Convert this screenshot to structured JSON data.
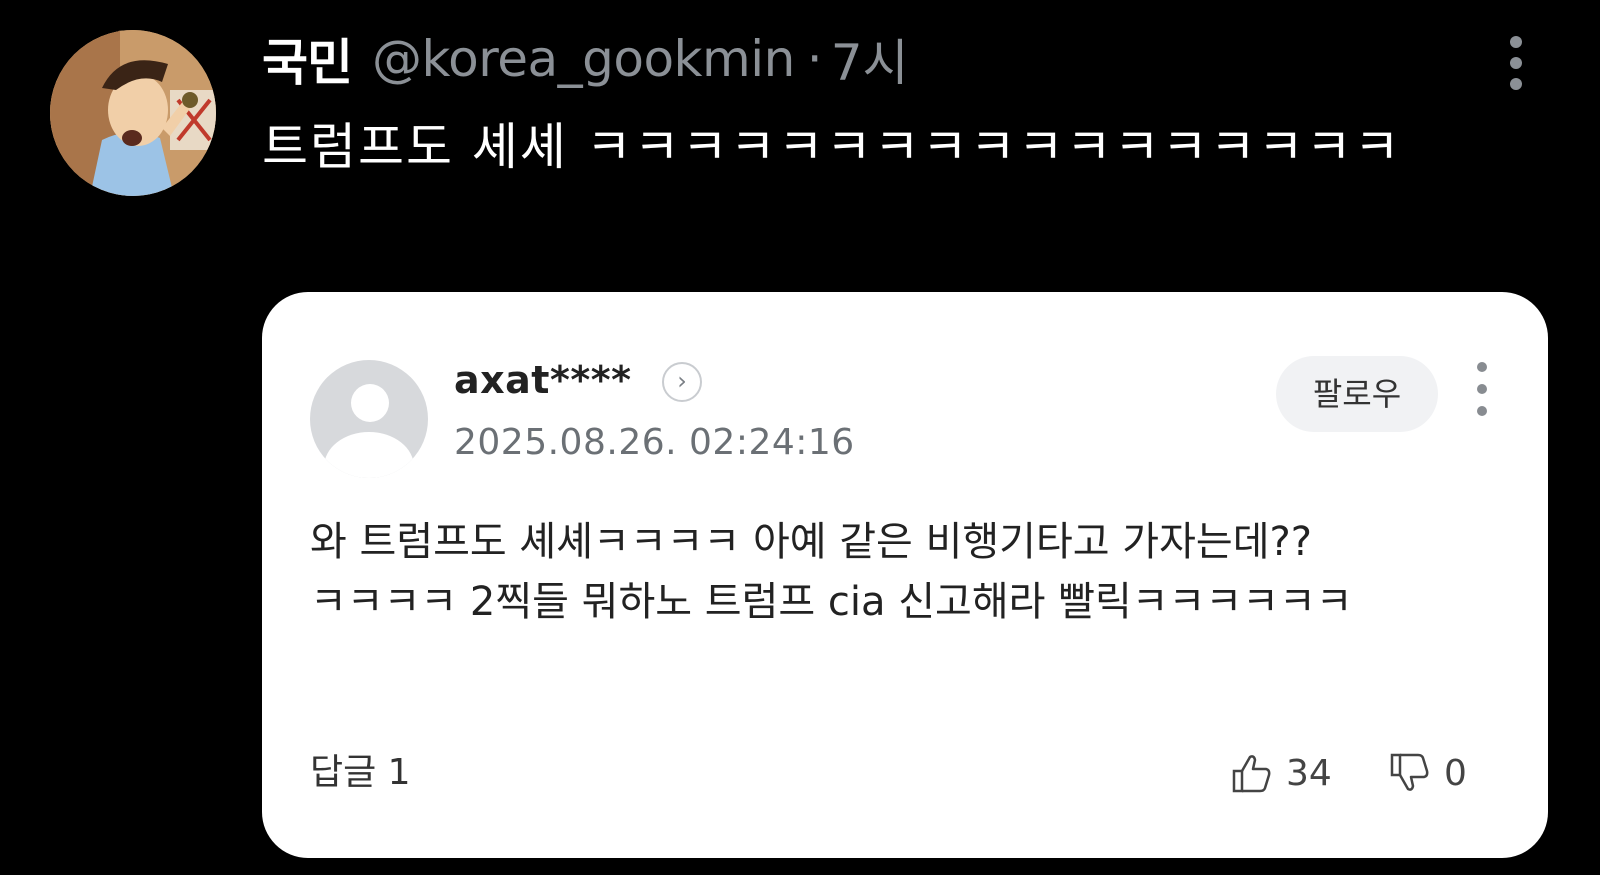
{
  "tweet": {
    "display_name": "국민",
    "handle": "@korea_gookmin",
    "separator": "·",
    "time": "7시",
    "text": "트럼프도 셰셰 ㅋㅋㅋㅋㅋㅋㅋㅋㅋㅋㅋㅋㅋㅋㅋㅋㅋ"
  },
  "embedded_comment": {
    "username": "axat****",
    "profile_chevron": "›",
    "date": "2025.08.26. 02:24:16",
    "follow_label": "팔로우",
    "body": "와 트럼프도 셰셰ㅋㅋㅋㅋ 아예 같은 비행기타고 가자는데?? ㅋㅋㅋㅋ 2찍들 뭐하노 트럼프 cia 신고해라 빨릭ㅋㅋㅋㅋㅋㅋ",
    "reply_label": "답글 1",
    "likes": "34",
    "dislikes": "0"
  },
  "icons": {
    "tweet_more": "more-vertical-icon",
    "comment_more": "more-vertical-icon",
    "like": "thumbs-up-icon",
    "dislike": "thumbs-down-icon",
    "chevron": "chevron-right-icon"
  },
  "colors": {
    "background": "#000000",
    "secondary_text": "#8b9096",
    "card_background": "#ffffff"
  }
}
